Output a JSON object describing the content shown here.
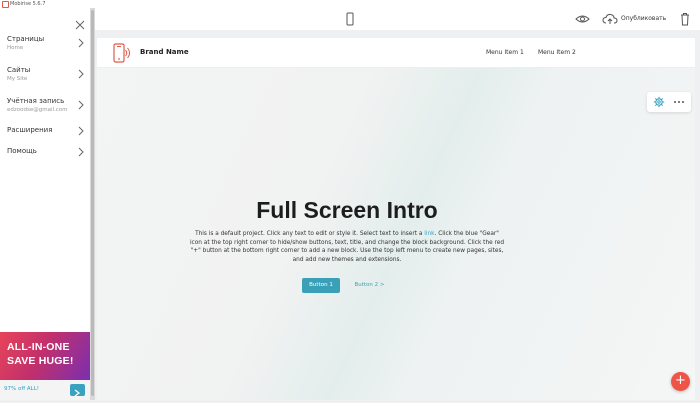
{
  "app": {
    "title": "Mobirise 5.6.7"
  },
  "sidebar": {
    "items": [
      {
        "label": "Страницы",
        "sub": "Home"
      },
      {
        "label": "Сайты",
        "sub": "My Site"
      },
      {
        "label": "Учётная запись",
        "sub": "edzoodse@gmail.com"
      },
      {
        "label": "Расширения",
        "sub": ""
      },
      {
        "label": "Помощь",
        "sub": ""
      }
    ],
    "promo": {
      "line1": "ALL-IN-ONE",
      "line2": "SAVE HUGE!",
      "footer": "97% off ALL!"
    }
  },
  "toolbar": {
    "publish_label": "Опубликовать"
  },
  "site": {
    "brand": "Brand Name",
    "menu": [
      "Menu Item 1",
      "Menu Item 2"
    ],
    "hero": {
      "title": "Full Screen Intro",
      "text_before_link": "This is a default project. Click any text to edit or style it. Select text to insert a ",
      "link_text": "link",
      "text_after_link": ". Click the blue \"Gear\" icon at the top right corner to hide/show buttons, text, title, and change the block background. Click the red \"+\" button at the bottom right corner to add a new block. Use the top left menu to create new pages, sites, and add new themes and extensions.",
      "button1": "Button 1",
      "button2": "Button 2 >"
    }
  },
  "colors": {
    "accent": "#3aa0b8",
    "fab": "#ef5546",
    "brand_icon": "#e05a4a"
  }
}
